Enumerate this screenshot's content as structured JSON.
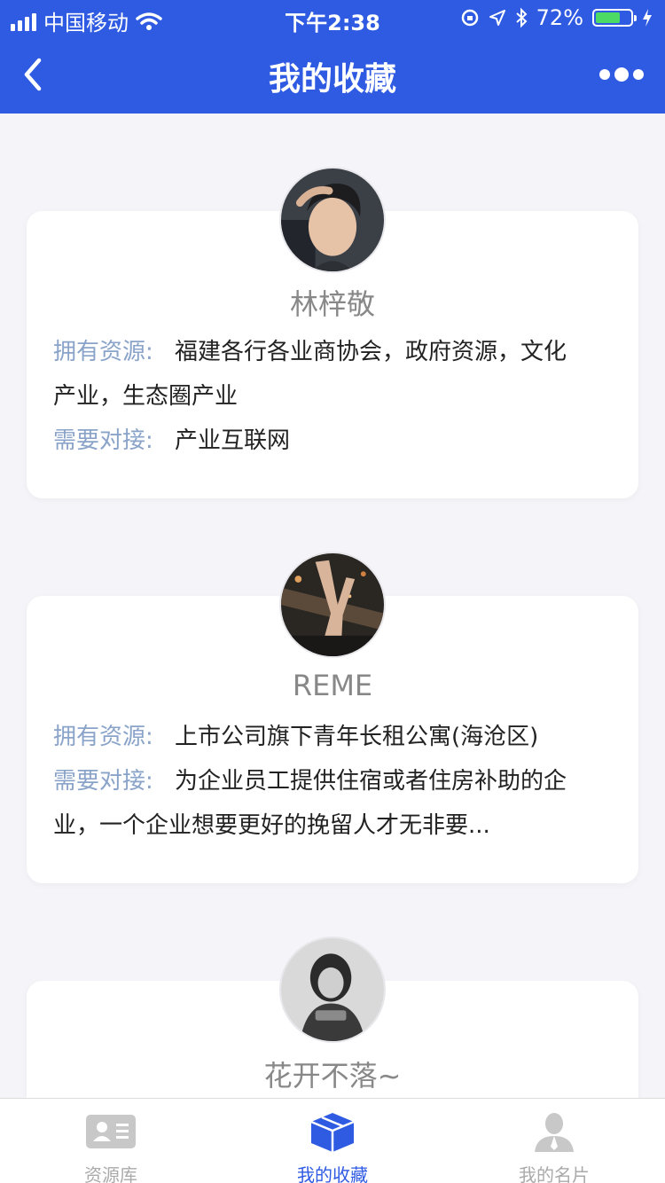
{
  "status": {
    "carrier": "中国移动",
    "time": "下午2:38",
    "battery": "72%",
    "battery_level": 0.72
  },
  "nav": {
    "title": "我的收藏"
  },
  "cards": [
    {
      "name": "林梓敬",
      "resources_label": "拥有资源:",
      "resources": "福建各行各业商协会，政府资源，文化",
      "resources_cont": "产业，生态圈产业",
      "needs_label": "需要对接:",
      "needs": "产业互联网"
    },
    {
      "name": "REME",
      "resources_label": "拥有资源:",
      "resources": "上市公司旗下青年长租公寓(海沧区)",
      "needs_label": "需要对接:",
      "needs": "为企业员工提供住宿或者住房补助的企",
      "needs_cont": "业，一个企业想要更好的挽留人才无非要..."
    },
    {
      "name": "花开不落~"
    }
  ],
  "tabs": [
    {
      "label": "资源库",
      "icon": "id-card-icon"
    },
    {
      "label": "我的收藏",
      "icon": "box-icon"
    },
    {
      "label": "我的名片",
      "icon": "person-icon"
    }
  ],
  "colors": {
    "accent": "#2f5be3",
    "label": "#8aa3c9",
    "background": "#f5f5f9"
  }
}
